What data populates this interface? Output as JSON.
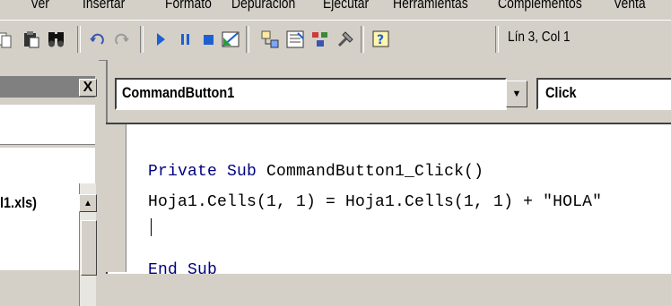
{
  "menu": {
    "items": [
      "Ver",
      "Insertar",
      "Formato",
      "Depuración",
      "Ejecutar",
      "Herramientas",
      "Complementos",
      "Venta"
    ]
  },
  "toolbar": {
    "icons": [
      "copy-icon",
      "paste-icon",
      "find-icon",
      "undo-icon",
      "redo-icon",
      "run-icon",
      "break-icon",
      "reset-icon",
      "design-mode-icon",
      "project-explorer-icon",
      "properties-icon",
      "object-browser-icon",
      "toolbox-icon",
      "help-icon"
    ],
    "status": "Lín 3, Col 1"
  },
  "left_panel": {
    "close_label": "X",
    "tree_item": "l1.xls)"
  },
  "code_window": {
    "object_combo": "CommandButton1",
    "procedure_combo": "Click",
    "lines": [
      {
        "kw": "Private Sub ",
        "text": "CommandButton1_Click()"
      },
      {
        "kw": "",
        "text": "Hoja1.Cells(1, 1) = Hoja1.Cells(1, 1) + \"HOLA\""
      },
      {
        "kw": "",
        "text": ""
      },
      {
        "kw": "End Sub",
        "text": ""
      }
    ]
  },
  "colors": {
    "keyword": "#00007f",
    "chrome": "#d4d0c8"
  }
}
